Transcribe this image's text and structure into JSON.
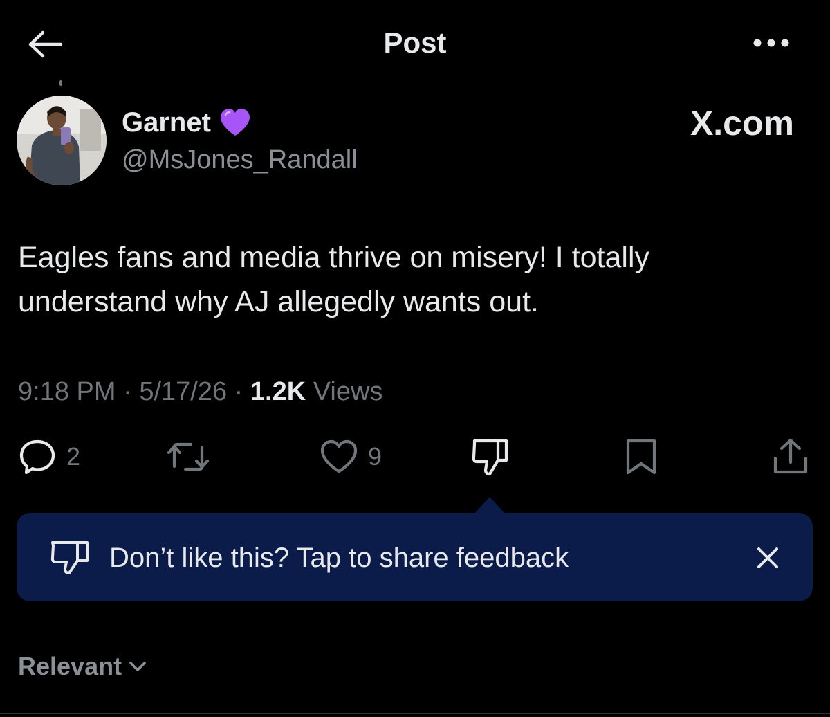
{
  "header": {
    "title": "Post",
    "back_icon": "arrow-left-icon",
    "more_icon": "ellipsis-icon"
  },
  "author": {
    "display_name": "Garnet",
    "emoji": "purple-heart",
    "handle": "@MsJones_Randall",
    "watermark": "X.com"
  },
  "post": {
    "text": "Eagles fans and media thrive on misery! I totally understand why AJ allegedly wants out."
  },
  "meta": {
    "time": "9:18 PM",
    "sep1": " · ",
    "date": "5/17/26",
    "sep2": " · ",
    "views_count": "1.2K",
    "views_label": " Views"
  },
  "actions": {
    "reply_count": "2",
    "like_count": "9"
  },
  "feedback": {
    "text": "Don’t like this? Tap to share feedback"
  },
  "sort": {
    "label": "Relevant"
  },
  "colors": {
    "background": "#000000",
    "primary_text": "#e7e9ea",
    "secondary_text": "#71767b",
    "banner": "#0b1b4a",
    "heart": "#a855f7"
  }
}
